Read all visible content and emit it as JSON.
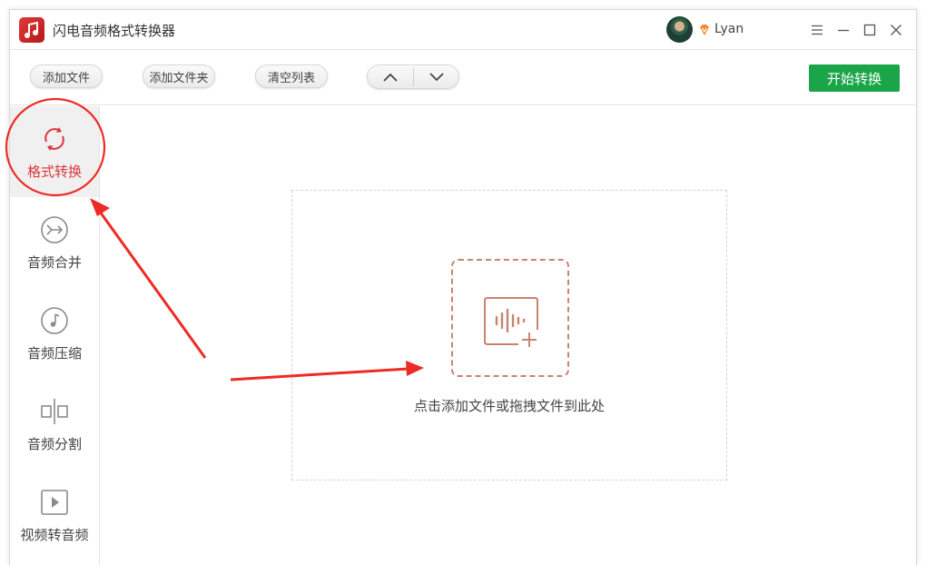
{
  "app": {
    "title": "闪电音频格式转换器",
    "user": {
      "name": "Lyan"
    },
    "icons": {
      "logo": "music-note-icon",
      "vip": "vip-diamond-icon"
    }
  },
  "window_controls": {
    "icons": [
      "menu-icon",
      "minimize-icon",
      "maximize-icon",
      "close-icon"
    ]
  },
  "toolbar": {
    "add_file": "添加文件",
    "add_folder": "添加文件夹",
    "clear_list": "清空列表",
    "start_convert": "开始转换",
    "icons": {
      "move_up": "chevron-up-icon",
      "move_down": "chevron-down-icon"
    }
  },
  "sidebar": {
    "items": [
      {
        "label": "格式转换",
        "icon": "refresh-icon",
        "active": true
      },
      {
        "label": "音频合并",
        "icon": "merge-icon",
        "active": false
      },
      {
        "label": "音频压缩",
        "icon": "music-disc-icon",
        "active": false
      },
      {
        "label": "音频分割",
        "icon": "split-icon",
        "active": false
      },
      {
        "label": "视频转音频",
        "icon": "video-play-icon",
        "active": false
      }
    ]
  },
  "dropzone": {
    "hint": "点击添加文件或拖拽文件到此处",
    "icon": "audio-add-icon"
  },
  "colors": {
    "accent_red": "#d9363a",
    "start_green": "#1aa548",
    "drop_border": "#c98370",
    "annotation_red": "#ee2a24"
  }
}
